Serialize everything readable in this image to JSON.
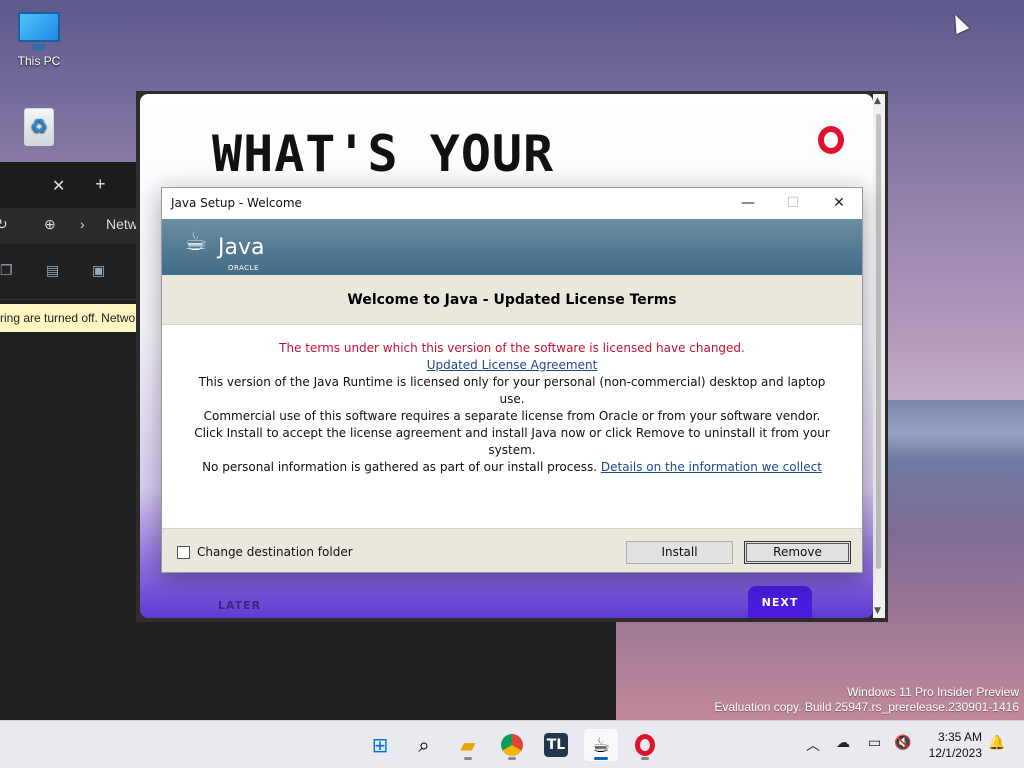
{
  "desktop": {
    "icons": [
      {
        "label": "This PC",
        "icon": "monitor-icon"
      },
      {
        "label": "Recycle Bin",
        "icon": "recycle-bin-icon"
      }
    ]
  },
  "explorer": {
    "address_text": "Netw",
    "info_bar_text": "ring are turned off. Netwo"
  },
  "opera_page": {
    "headline": "WHAT'S YOUR",
    "later_label": "LATER",
    "next_label": "NEXT",
    "logo": "opera-logo-icon",
    "logo_color": "#e1112d"
  },
  "java_dialog": {
    "title": "Java Setup - Welcome",
    "window_buttons": {
      "minimize": "—",
      "maximize": "☐",
      "close": "✕"
    },
    "logo_text": "Java",
    "logo_sub": "ORACLE",
    "header": "Welcome to Java - Updated License Terms",
    "warning": "The terms under which this version of the software is licensed have changed.",
    "license_link": "Updated License Agreement",
    "para1": "This version of the Java Runtime is licensed only for your personal (non-commercial) desktop and laptop use.",
    "para2": "Commercial use of this software requires a separate license from Oracle or from your software vendor.",
    "para3": "Click Install to accept the license agreement and install Java now or click Remove to uninstall it from your system.",
    "para4": "No personal information is gathered as part of our install process.",
    "details_link": "Details on the information we collect",
    "checkbox_label": "Change destination folder",
    "checkbox_checked": false,
    "install_label": "Install",
    "remove_label": "Remove",
    "warning_color": "#c8102e",
    "banner_color": "#527a93"
  },
  "watermark": {
    "line1": "Windows 11 Pro Insider Preview",
    "line2": "Evaluation copy. Build 25947.rs_prerelease.230901-1416"
  },
  "taskbar": {
    "apps": [
      {
        "name": "start",
        "icon": "windows-start-icon"
      },
      {
        "name": "search",
        "icon": "search-icon"
      },
      {
        "name": "file-explorer",
        "icon": "folder-icon"
      },
      {
        "name": "chrome",
        "icon": "chrome-icon"
      },
      {
        "name": "tl",
        "icon": "tl-app-icon",
        "text": "TL"
      },
      {
        "name": "java-setup",
        "icon": "java-setup-icon"
      },
      {
        "name": "opera",
        "icon": "opera-icon"
      }
    ],
    "clock_time": "3:35 AM",
    "clock_date": "12/1/2023",
    "accent": "#0067c0"
  }
}
